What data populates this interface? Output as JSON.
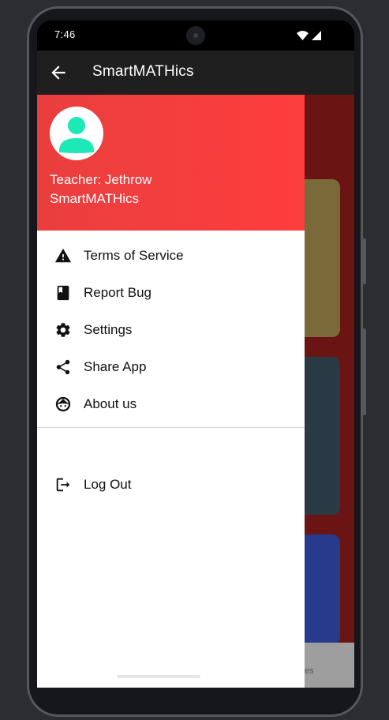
{
  "status_bar": {
    "time": "7:46",
    "icons": [
      "wifi-icon",
      "signal-icon"
    ]
  },
  "app_bar": {
    "title": "SmartMATHics",
    "back_icon": "arrow-left-icon"
  },
  "drawer": {
    "header": {
      "avatar_icon": "person-icon",
      "teacher_line": "Teacher: Jethrow\nSmartMATHics",
      "accent_color": "#ff3d3d",
      "avatar_color": "#1de9b6"
    },
    "items": [
      {
        "label": "Terms of Service",
        "icon": "warning-icon"
      },
      {
        "label": "Report Bug",
        "icon": "book-icon"
      },
      {
        "label": "Settings",
        "icon": "gear-icon"
      },
      {
        "label": "Share App",
        "icon": "share-icon"
      },
      {
        "label": "About us",
        "icon": "face-icon"
      }
    ],
    "logout": {
      "label": "Log Out",
      "icon": "logout-icon"
    }
  },
  "background": {
    "bottom_nav_fragment": "es"
  }
}
